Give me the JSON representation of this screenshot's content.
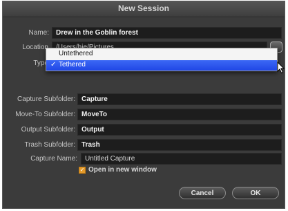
{
  "window": {
    "title": "New Session"
  },
  "form": {
    "name_label": "Name:",
    "name_value": "Drew in the Goblin forest",
    "location_label": "Location",
    "location_value": "/Users/hie/Pictures",
    "type_label": "Type",
    "type_menu": {
      "options": [
        "Untethered",
        "Tethered"
      ],
      "selected_check": "✓"
    },
    "capture_subfolder_label": "Capture Subfolder:",
    "capture_subfolder_value": "Capture",
    "moveto_subfolder_label": "Move-To Subfolder:",
    "moveto_subfolder_value": "MoveTo",
    "output_subfolder_label": "Output Subfolder:",
    "output_subfolder_value": "Output",
    "trash_subfolder_label": "Trash Subfolder:",
    "trash_subfolder_value": "Trash",
    "capture_name_label": "Capture Name:",
    "capture_name_value": "Untitled Capture",
    "open_new_window_label": "Open in new window",
    "open_new_window_checked": true
  },
  "buttons": {
    "cancel": "Cancel",
    "ok": "OK"
  },
  "icons": {
    "choose_folder": "folder-choose-icon",
    "cursor": "mouse-pointer-icon",
    "checkmark": "checkmark-icon"
  },
  "colors": {
    "window_bg": "#3b3b3b",
    "field_bg": "#1d1d1d",
    "selection": "#2a55ee",
    "checkbox": "#e39a2a"
  }
}
